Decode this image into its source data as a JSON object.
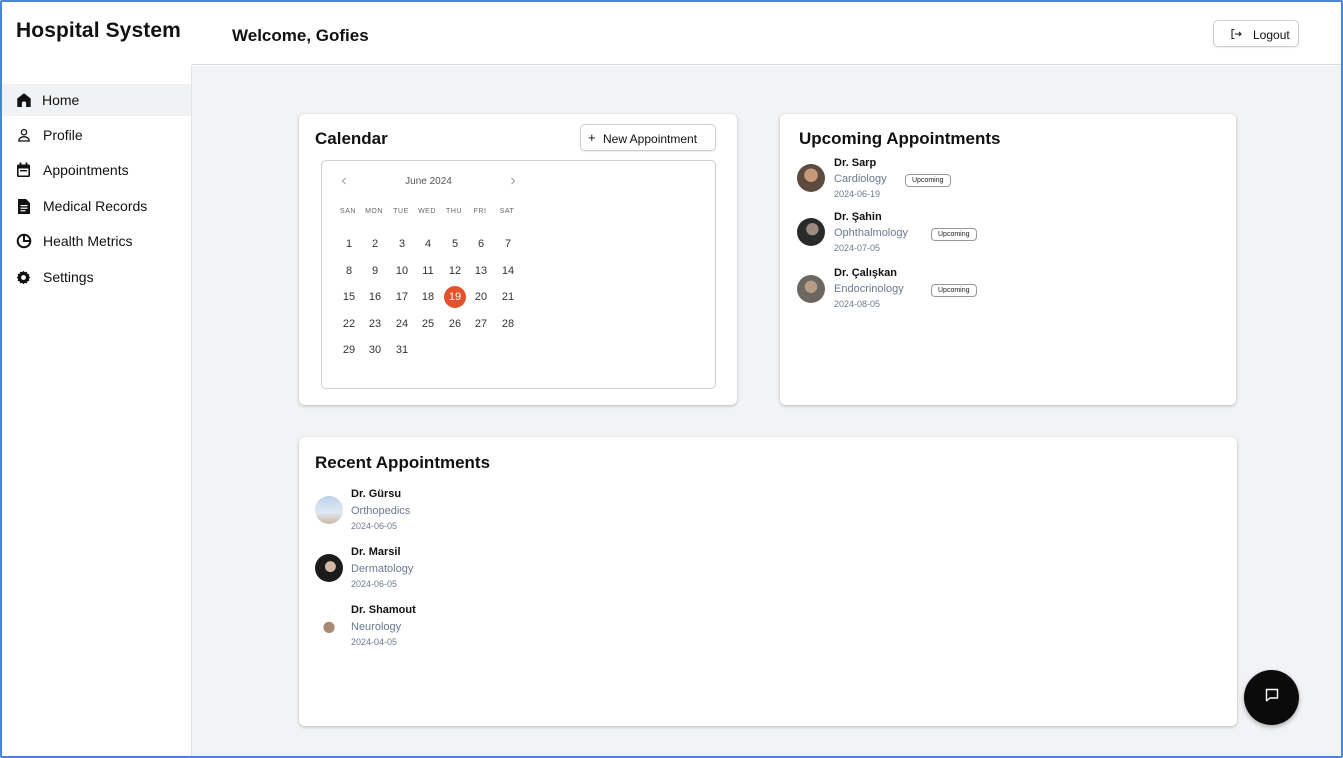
{
  "app": {
    "title": "Hospital System"
  },
  "header": {
    "welcome": "Welcome, Gofies",
    "logout_label": "Logout"
  },
  "sidebar": {
    "items": [
      {
        "label": "Home",
        "icon": "home-icon",
        "active": true
      },
      {
        "label": "Profile",
        "icon": "user-icon"
      },
      {
        "label": "Appointments",
        "icon": "calendar-icon"
      },
      {
        "label": "Medical Records",
        "icon": "document-icon"
      },
      {
        "label": "Health Metrics",
        "icon": "pie-chart-icon"
      },
      {
        "label": "Settings",
        "icon": "gear-icon"
      }
    ]
  },
  "calendar": {
    "title": "Calendar",
    "new_appointment_label": "New Appointment",
    "month_label": "June 2024",
    "weekdays": [
      "SAN",
      "MON",
      "TUE",
      "WED",
      "THU",
      "FRI",
      "SAT"
    ],
    "selected_day": 19,
    "highlight_color": "#e4522b"
  },
  "upcoming": {
    "title": "Upcoming Appointments",
    "items": [
      {
        "doctor": "Dr. Sarp",
        "specialty": "Cardiology",
        "date": "2024-06-19",
        "status": "Upcoming"
      },
      {
        "doctor": "Dr. Şahin",
        "specialty": "Ophthalmology",
        "date": "2024-07-05",
        "status": "Upcoming"
      },
      {
        "doctor": "Dr. Çalışkan",
        "specialty": "Endocrinology",
        "date": "2024-08-05",
        "status": "Upcoming"
      }
    ]
  },
  "recent": {
    "title": "Recent Appointments",
    "items": [
      {
        "doctor": "Dr. Gürsu",
        "specialty": "Orthopedics",
        "date": "2024-06-05"
      },
      {
        "doctor": "Dr. Marsil",
        "specialty": "Dermatology",
        "date": "2024-06-05"
      },
      {
        "doctor": "Dr. Shamout",
        "specialty": "Neurology",
        "date": "2024-04-05"
      }
    ]
  },
  "chat": {
    "icon": "chat-icon"
  }
}
